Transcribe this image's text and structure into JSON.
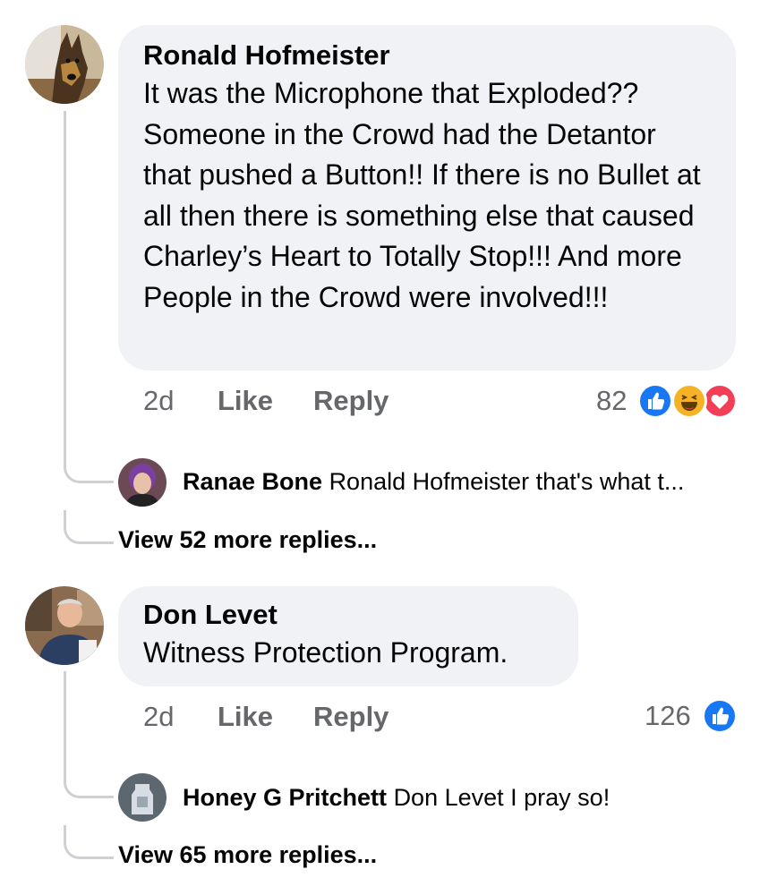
{
  "comments": [
    {
      "author": "Ronald Hofmeister",
      "text": "It was the Microphone that Exploded?? Someone in the Crowd had the Detantor that pushed a Button!! If there is no Bullet at all then there is something else that caused Charley’s Heart to Totally Stop!!! And more People in the Crowd were involved!!!",
      "time": "2d",
      "like_label": "Like",
      "reply_label": "Reply",
      "reaction_count": "82",
      "reactions": [
        "like-icon",
        "haha-icon",
        "love-icon"
      ],
      "reply_preview": {
        "author": "Ranae Bone",
        "text": "Ronald Hofmeister that's what t..."
      },
      "view_more": "View 52 more replies..."
    },
    {
      "author": "Don Levet",
      "text": "Witness Protection Program.",
      "time": "2d",
      "like_label": "Like",
      "reply_label": "Reply",
      "reaction_count": "126",
      "reactions": [
        "like-icon"
      ],
      "reply_preview": {
        "author": "Honey G Pritchett",
        "text": "Don Levet I pray so!"
      },
      "view_more": "View 65 more replies..."
    }
  ],
  "colors": {
    "like_blue": "#1877f2",
    "love_red": "#f33e58",
    "haha_yellow": "#f7b125",
    "meta_gray": "#65676b",
    "bubble_bg": "#f0f2f5"
  }
}
